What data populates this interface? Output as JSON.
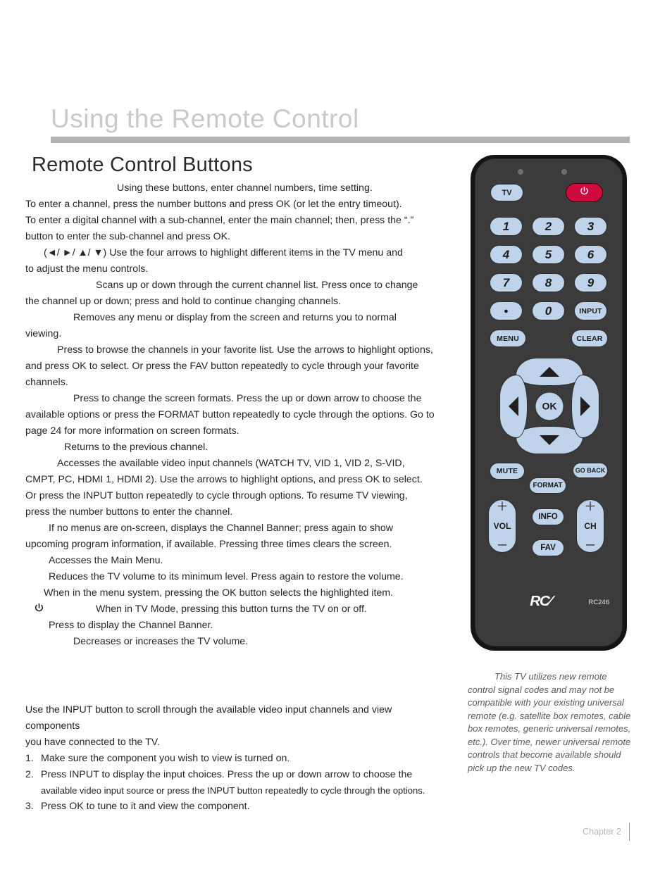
{
  "header": {
    "chapter_title": "Using the Remote Control",
    "section_title": "Remote Control Buttons"
  },
  "body": {
    "paragraphs": [
      "Using these buttons, enter channel numbers, time setting.",
      "To enter a channel, press the number buttons and press OK (or let the entry timeout).",
      "To enter a digital channel with a sub-channel, enter the main channel; then, press the “.”",
      "button to enter the sub-channel and press OK.",
      "(◄/ ►/ ▲/ ▼) Use the four arrows to highlight different items in the TV menu and",
      "to adjust the menu controls.",
      "Scans up or down through the current channel list. Press once to change",
      "the channel up or down; press and hold to continue changing channels.",
      "Removes any menu or display from the screen and returns you to normal",
      "viewing.",
      "Press to browse the channels in your favorite list. Use the arrows to highlight options,",
      "and press OK to select.  Or press the FAV button repeatedly to cycle through your favorite",
      "channels.",
      "Press to change the screen formats. Press the up or down arrow to choose the",
      "available options or press the FORMAT button repeatedly to cycle through the options. Go to",
      "page 24 for more information on screen formats.",
      "Returns to the previous channel.",
      "Accesses the available video input channels (WATCH TV, VID 1, VID 2, S-VID,",
      "CMPT, PC, HDMI 1, HDMI 2). Use the arrows to highlight options, and press OK to select.",
      "Or press the INPUT button repeatedly to cycle through options.  To resume TV viewing,",
      "press the number buttons to enter the channel.",
      "If no menus are on-screen, displays the Channel Banner; press again to show",
      "upcoming program information, if available. Pressing three times clears the screen.",
      "Accesses the Main Menu.",
      "Reduces the TV volume to its minimum level. Press again to restore the volume.",
      "When in the menu system, pressing the OK button selects the highlighted item.",
      "When in TV Mode, pressing this button turns the TV on or off.",
      "Press to display the Channel Banner.",
      "Decreases or increases the TV volume."
    ],
    "power_glyph": "⏻"
  },
  "input_instructions": {
    "intro_line_1": "Use the INPUT button to scroll through the available video input channels and view components",
    "intro_line_2": "you have connected to the TV.",
    "steps": [
      {
        "num": "1.",
        "text": "Make sure the component you wish to view is turned on."
      },
      {
        "num": "2.",
        "text": "Press INPUT to display the input choices.  Press the up or down arrow to choose the"
      },
      {
        "num": "3.",
        "text": "Press OK to tune to it and view the component."
      }
    ],
    "step2_continuation": "available video input source or press the INPUT button repeatedly to cycle through the options."
  },
  "remote": {
    "model": "RC246",
    "brand": "RC∕",
    "buttons": {
      "tv": "TV",
      "power": "power-icon",
      "n1": "1",
      "n2": "2",
      "n3": "3",
      "n4": "4",
      "n5": "5",
      "n6": "6",
      "n7": "7",
      "n8": "8",
      "n9": "9",
      "dot": "●",
      "n0": "0",
      "input": "INPUT",
      "menu": "MENU",
      "clear": "CLEAR",
      "ok": "OK",
      "mute": "MUTE",
      "go_back": "GO BACK",
      "format": "FORMAT",
      "info": "INFO",
      "fav": "FAV",
      "vol": "VOL",
      "ch": "CH",
      "plus": "＋",
      "minus": "─"
    },
    "note": "This TV utilizes new remote control signal codes and may not be compatible with your existing universal remote (e.g. satellite box remotes, cable box remotes, generic universal remotes, etc.). Over time, newer universal remote controls that become available should pick up the new TV codes."
  },
  "footer": {
    "chapter": "Chapter 2"
  },
  "colors": {
    "header_rule": "#b2b2b2",
    "chapter_title": "#c9c9c9",
    "remote_body": "#3b3b3b",
    "remote_frame": "#141414",
    "button_face": "#bfd4ea",
    "power_red": "#cf0a3c",
    "note_text": "#5b5b5b"
  }
}
